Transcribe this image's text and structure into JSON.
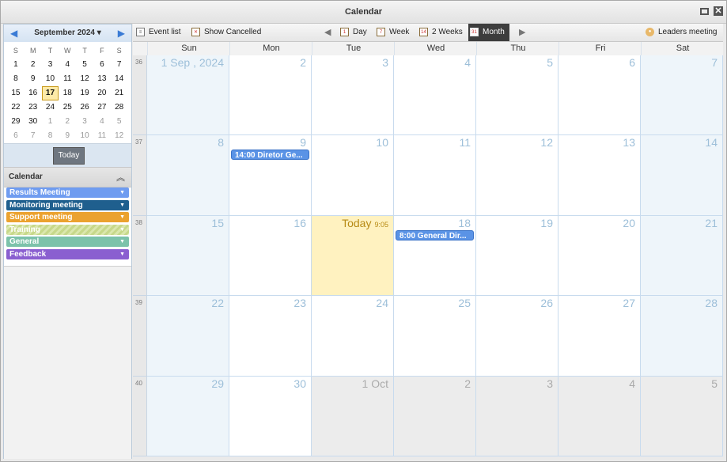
{
  "window": {
    "title": "Calendar"
  },
  "mini_calendar": {
    "month_label": "September 2024",
    "weekday_headers": [
      "S",
      "M",
      "T",
      "W",
      "T",
      "F",
      "S"
    ],
    "weeks": [
      [
        {
          "d": "1"
        },
        {
          "d": "2"
        },
        {
          "d": "3"
        },
        {
          "d": "4"
        },
        {
          "d": "5"
        },
        {
          "d": "6"
        },
        {
          "d": "7"
        }
      ],
      [
        {
          "d": "8"
        },
        {
          "d": "9"
        },
        {
          "d": "10"
        },
        {
          "d": "11"
        },
        {
          "d": "12"
        },
        {
          "d": "13"
        },
        {
          "d": "14"
        }
      ],
      [
        {
          "d": "15"
        },
        {
          "d": "16"
        },
        {
          "d": "17",
          "today": true
        },
        {
          "d": "18"
        },
        {
          "d": "19"
        },
        {
          "d": "20"
        },
        {
          "d": "21"
        }
      ],
      [
        {
          "d": "22"
        },
        {
          "d": "23"
        },
        {
          "d": "24"
        },
        {
          "d": "25"
        },
        {
          "d": "26"
        },
        {
          "d": "27"
        },
        {
          "d": "28"
        }
      ],
      [
        {
          "d": "29"
        },
        {
          "d": "30"
        },
        {
          "d": "1",
          "other": true
        },
        {
          "d": "2",
          "other": true
        },
        {
          "d": "3",
          "other": true
        },
        {
          "d": "4",
          "other": true
        },
        {
          "d": "5",
          "other": true
        }
      ],
      [
        {
          "d": "6",
          "other": true
        },
        {
          "d": "7",
          "other": true
        },
        {
          "d": "8",
          "other": true
        },
        {
          "d": "9",
          "other": true
        },
        {
          "d": "10",
          "other": true
        },
        {
          "d": "11",
          "other": true
        },
        {
          "d": "12",
          "other": true
        }
      ]
    ],
    "today_button": "Today"
  },
  "calendars": {
    "header": "Calendar",
    "items": [
      {
        "label": "Results Meeting",
        "color": "#6f9cf0"
      },
      {
        "label": "Monitoring meeting",
        "color": "#1f5f8e"
      },
      {
        "label": "Support meeting",
        "color": "#eba22f"
      },
      {
        "label": "Training",
        "color": "#c7d88a"
      },
      {
        "label": "General",
        "color": "#7cc2aa"
      },
      {
        "label": "Feedback",
        "color": "#8a5fd0"
      }
    ]
  },
  "toolbar": {
    "event_list": "Event list",
    "show_cancelled": "Show Cancelled",
    "day": "Day",
    "week": "Week",
    "two_weeks": "2 Weeks",
    "month": "Month",
    "leaders_meeting": "Leaders meeting"
  },
  "month_view": {
    "weekdays": [
      "Sun",
      "Mon",
      "Tue",
      "Wed",
      "Thu",
      "Fri",
      "Sat"
    ],
    "weeks": [
      {
        "week": "36",
        "days": [
          {
            "label": "1 Sep , 2024",
            "type": "wkend"
          },
          {
            "label": "2"
          },
          {
            "label": "3"
          },
          {
            "label": "4"
          },
          {
            "label": "5"
          },
          {
            "label": "6"
          },
          {
            "label": "7",
            "type": "wkend"
          }
        ]
      },
      {
        "week": "37",
        "days": [
          {
            "label": "8",
            "type": "wkend"
          },
          {
            "label": "9",
            "event": "14:00 Diretor Ge..."
          },
          {
            "label": "10"
          },
          {
            "label": "11"
          },
          {
            "label": "12"
          },
          {
            "label": "13"
          },
          {
            "label": "14",
            "type": "wkend"
          }
        ]
      },
      {
        "week": "38",
        "days": [
          {
            "label": "15",
            "type": "wkend"
          },
          {
            "label": "16"
          },
          {
            "label": "Today",
            "time": "9:05",
            "type": "today"
          },
          {
            "label": "18",
            "event": "8:00 General Dir..."
          },
          {
            "label": "19"
          },
          {
            "label": "20"
          },
          {
            "label": "21",
            "type": "wkend"
          }
        ]
      },
      {
        "week": "39",
        "days": [
          {
            "label": "22",
            "type": "wkend"
          },
          {
            "label": "23"
          },
          {
            "label": "24"
          },
          {
            "label": "25"
          },
          {
            "label": "26"
          },
          {
            "label": "27"
          },
          {
            "label": "28",
            "type": "wkend"
          }
        ]
      },
      {
        "week": "40",
        "days": [
          {
            "label": "29",
            "type": "wkend"
          },
          {
            "label": "30"
          },
          {
            "label": "1 Oct",
            "type": "other"
          },
          {
            "label": "2",
            "type": "other"
          },
          {
            "label": "3",
            "type": "other"
          },
          {
            "label": "4",
            "type": "other"
          },
          {
            "label": "5",
            "type": "other"
          }
        ]
      }
    ]
  }
}
